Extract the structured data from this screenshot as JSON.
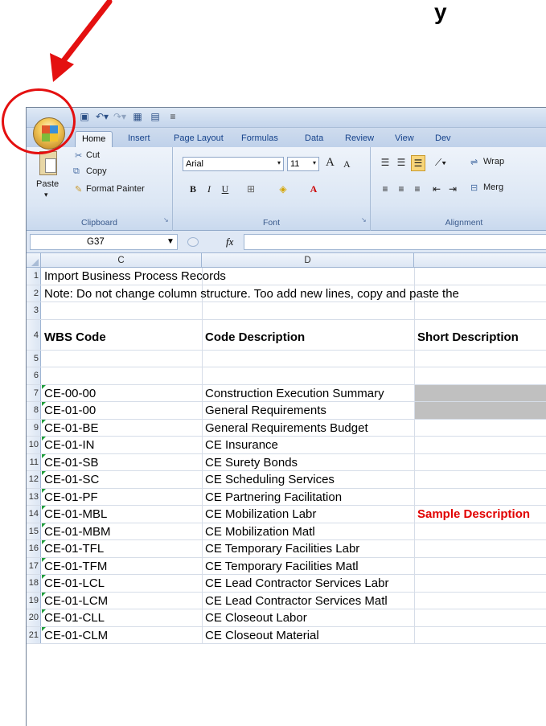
{
  "heading": "y",
  "quick_access": {
    "save_icon": "save-icon",
    "undo_icon": "undo-icon",
    "redo_icon": "redo-icon"
  },
  "tabs": [
    "Home",
    "Insert",
    "Page Layout",
    "Formulas",
    "Data",
    "Review",
    "View",
    "Dev"
  ],
  "ribbon": {
    "clipboard": {
      "paste": "Paste",
      "cut": "Cut",
      "copy": "Copy",
      "format_painter": "Format Painter",
      "label": "Clipboard"
    },
    "font": {
      "name": "Arial",
      "size": "11",
      "label": "Font",
      "bold": "B",
      "italic": "I",
      "underline": "U"
    },
    "alignment": {
      "wrap": "Wrap",
      "merge": "Merg",
      "label": "Alignment"
    }
  },
  "formula_bar": {
    "name_box": "G37",
    "fx": "fx"
  },
  "columns": [
    "C",
    "D"
  ],
  "rows": [
    {
      "n": "1",
      "c": "Import Business Process Records",
      "d": "",
      "e": ""
    },
    {
      "n": "2",
      "c": "Note: Do not change column structure.  Too add new lines, copy and paste the",
      "d": "",
      "e": ""
    },
    {
      "n": "3",
      "c": "",
      "d": "",
      "e": ""
    },
    {
      "n": "4",
      "c": "WBS Code",
      "d": "Code Description",
      "e": "Short Description"
    },
    {
      "n": "5",
      "c": "",
      "d": "",
      "e": ""
    },
    {
      "n": "6",
      "c": "",
      "d": "",
      "e": ""
    },
    {
      "n": "7",
      "c": "CE-00-00",
      "d": "Construction Execution Summary",
      "e": ""
    },
    {
      "n": "8",
      "c": "CE-01-00",
      "d": "General Requirements",
      "e": ""
    },
    {
      "n": "9",
      "c": "CE-01-BE",
      "d": "General Requirements Budget",
      "e": ""
    },
    {
      "n": "10",
      "c": "CE-01-IN",
      "d": "CE Insurance",
      "e": ""
    },
    {
      "n": "11",
      "c": "CE-01-SB",
      "d": "CE Surety Bonds",
      "e": ""
    },
    {
      "n": "12",
      "c": "CE-01-SC",
      "d": "CE Scheduling Services",
      "e": ""
    },
    {
      "n": "13",
      "c": "CE-01-PF",
      "d": "CE Partnering Facilitation",
      "e": ""
    },
    {
      "n": "14",
      "c": "CE-01-MBL",
      "d": "CE Mobilization Labr",
      "e": "Sample Description"
    },
    {
      "n": "15",
      "c": "CE-01-MBM",
      "d": "CE Mobilization Matl",
      "e": ""
    },
    {
      "n": "16",
      "c": "CE-01-TFL",
      "d": "CE Temporary Facilities Labr",
      "e": ""
    },
    {
      "n": "17",
      "c": "CE-01-TFM",
      "d": "CE Temporary Facilities Matl",
      "e": ""
    },
    {
      "n": "18",
      "c": "CE-01-LCL",
      "d": "CE Lead Contractor Services Labr",
      "e": ""
    },
    {
      "n": "19",
      "c": "CE-01-LCM",
      "d": "CE Lead Contractor Services Matl",
      "e": ""
    },
    {
      "n": "20",
      "c": "CE-01-CLL",
      "d": "CE Closeout Labor",
      "e": ""
    },
    {
      "n": "21",
      "c": "CE-01-CLM",
      "d": "CE Closeout Material",
      "e": ""
    }
  ]
}
